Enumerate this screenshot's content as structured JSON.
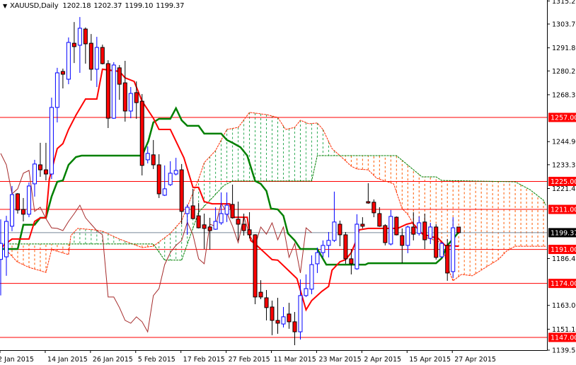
{
  "header": {
    "dropdown_icon": "triangle-down-icon",
    "symbol_timeframe": "XAUUSD,Daily",
    "ohlc": [
      "1202.18",
      "1202.37",
      "1199.10",
      "1199.37"
    ]
  },
  "colors": {
    "up_candle": "#0000ff",
    "down_candle_fill": "#ff0000",
    "down_candle_outline": "#000000",
    "tenkan": "#ff0000",
    "kijun": "#008000",
    "senkou_a": "#ff2a00",
    "senkou_b": "#008000",
    "chikou": "#a52a2a",
    "cloud_bear_hatch": "#ff5a00",
    "cloud_bull_hatch": "#2eaa55",
    "level_line": "#ff0000",
    "current_price_line": "#778899"
  },
  "chart_data": {
    "type": "candlestick",
    "title": "XAUUSD,Daily",
    "indicator": "Ichimoku Kinko Hyo",
    "ylim": [
      1139.55,
      1315.25
    ],
    "y_ticks": [
      "1315.25",
      "1303.70",
      "1291.80",
      "1280.25",
      "1268.35",
      "1244.90",
      "1233.35",
      "1221.45",
      "1186.45",
      "1163.00",
      "1151.10",
      "1139.55"
    ],
    "x_tick_labels": [
      {
        "bar": 0,
        "label": "2 Jan 2015"
      },
      {
        "bar": 8,
        "label": "14 Jan 2015"
      },
      {
        "bar": 16,
        "label": "26 Jan 2015"
      },
      {
        "bar": 24,
        "label": "5 Feb 2015"
      },
      {
        "bar": 32,
        "label": "17 Feb 2015"
      },
      {
        "bar": 40,
        "label": "27 Feb 2015"
      },
      {
        "bar": 48,
        "label": "11 Mar 2015"
      },
      {
        "bar": 56,
        "label": "23 Mar 2015"
      },
      {
        "bar": 64,
        "label": "2 Apr 2015"
      },
      {
        "bar": 72,
        "label": "15 Apr 2015"
      },
      {
        "bar": 80,
        "label": "27 Apr 2015"
      }
    ],
    "levels": [
      {
        "price": 1257.0,
        "label": "1257.00"
      },
      {
        "price": 1225.0,
        "label": "1225.00"
      },
      {
        "price": 1211.0,
        "label": "1211.00"
      },
      {
        "price": 1191.0,
        "label": "1191.00"
      },
      {
        "price": 1174.0,
        "label": "1174.00"
      },
      {
        "price": 1147.0,
        "label": "1147.00"
      }
    ],
    "current_price": {
      "price": 1199.37,
      "label": "1199.37"
    },
    "ohlc": [
      [
        1186.0,
        1206.0,
        1168.0,
        1194.0
      ],
      [
        1187.3,
        1207.8,
        1177.8,
        1205.0
      ],
      [
        1202.6,
        1222.7,
        1200.1,
        1218.4
      ],
      [
        1218.8,
        1219.2,
        1208.9,
        1210.7
      ],
      [
        1211.0,
        1216.7,
        1205.0,
        1208.6
      ],
      [
        1208.6,
        1224.5,
        1207.1,
        1222.7
      ],
      [
        1223.8,
        1235.8,
        1217.4,
        1233.7
      ],
      [
        1233.3,
        1244.3,
        1227.3,
        1230.8
      ],
      [
        1230.8,
        1244.3,
        1225.5,
        1228.7
      ],
      [
        1228.7,
        1266.9,
        1226.2,
        1262.0
      ],
      [
        1262.0,
        1281.8,
        1254.5,
        1279.3
      ],
      [
        1280.0,
        1281.4,
        1271.5,
        1278.6
      ],
      [
        1276.1,
        1297.0,
        1273.6,
        1294.5
      ],
      [
        1294.1,
        1304.7,
        1284.2,
        1292.4
      ],
      [
        1293.1,
        1307.2,
        1279.3,
        1301.6
      ],
      [
        1301.2,
        1302.0,
        1283.9,
        1293.8
      ],
      [
        1294.1,
        1298.7,
        1275.4,
        1281.1
      ],
      [
        1281.1,
        1297.3,
        1272.2,
        1292.0
      ],
      [
        1292.0,
        1293.4,
        1283.5,
        1283.9
      ],
      [
        1283.9,
        1285.6,
        1251.7,
        1256.6
      ],
      [
        1256.6,
        1284.6,
        1256.3,
        1283.2
      ],
      [
        1281.8,
        1283.2,
        1265.8,
        1273.6
      ],
      [
        1274.3,
        1285.3,
        1254.9,
        1260.2
      ],
      [
        1260.2,
        1272.2,
        1256.6,
        1269.0
      ],
      [
        1269.4,
        1275.0,
        1256.3,
        1264.4
      ],
      [
        1265.1,
        1268.7,
        1228.0,
        1233.0
      ],
      [
        1235.8,
        1242.5,
        1234.0,
        1239.0
      ],
      [
        1238.3,
        1245.7,
        1231.2,
        1233.3
      ],
      [
        1233.3,
        1238.6,
        1216.7,
        1218.8
      ],
      [
        1218.1,
        1233.0,
        1217.7,
        1221.3
      ],
      [
        1223.4,
        1235.1,
        1222.7,
        1229.1
      ],
      [
        1228.7,
        1236.8,
        1228.0,
        1230.5
      ],
      [
        1230.8,
        1233.7,
        1203.6,
        1210.0
      ],
      [
        1208.9,
        1213.5,
        1198.3,
        1212.1
      ],
      [
        1212.8,
        1221.3,
        1206.1,
        1206.4
      ],
      [
        1207.8,
        1214.2,
        1201.5,
        1201.8
      ],
      [
        1203.3,
        1208.9,
        1191.2,
        1201.5
      ],
      [
        1202.2,
        1206.8,
        1190.9,
        1200.4
      ],
      [
        1201.1,
        1212.1,
        1200.8,
        1205.0
      ],
      [
        1204.3,
        1219.5,
        1203.3,
        1208.9
      ],
      [
        1208.6,
        1219.5,
        1204.7,
        1213.1
      ],
      [
        1213.5,
        1223.4,
        1206.4,
        1206.8
      ],
      [
        1206.1,
        1214.9,
        1195.5,
        1203.6
      ],
      [
        1203.6,
        1208.9,
        1197.9,
        1200.4
      ],
      [
        1200.8,
        1209.6,
        1196.5,
        1198.3
      ],
      [
        1198.3,
        1198.6,
        1163.6,
        1167.2
      ],
      [
        1169.6,
        1175.6,
        1166.1,
        1167.2
      ],
      [
        1166.8,
        1170.7,
        1155.5,
        1161.9
      ],
      [
        1162.2,
        1165.4,
        1148.1,
        1155.5
      ],
      [
        1155.5,
        1166.8,
        1148.8,
        1154.1
      ],
      [
        1153.7,
        1162.2,
        1152.0,
        1157.3
      ],
      [
        1158.7,
        1164.3,
        1151.3,
        1154.8
      ],
      [
        1154.8,
        1159.7,
        1143.1,
        1149.8
      ],
      [
        1149.8,
        1176.0,
        1145.9,
        1167.9
      ],
      [
        1167.9,
        1178.5,
        1167.2,
        1171.4
      ],
      [
        1171.1,
        1188.0,
        1168.6,
        1183.4
      ],
      [
        1183.8,
        1191.9,
        1179.2,
        1189.4
      ],
      [
        1189.4,
        1195.5,
        1187.0,
        1193.0
      ],
      [
        1193.0,
        1199.7,
        1187.0,
        1195.5
      ],
      [
        1195.5,
        1219.9,
        1194.7,
        1204.7
      ],
      [
        1203.6,
        1205.4,
        1192.6,
        1198.3
      ],
      [
        1198.3,
        1199.7,
        1183.8,
        1186.3
      ],
      [
        1186.3,
        1191.2,
        1178.5,
        1183.8
      ],
      [
        1181.3,
        1208.6,
        1180.8,
        1203.6
      ],
      [
        1203.6,
        1207.1,
        1201.5,
        1202.6
      ],
      [
        1214.9,
        1224.1,
        1213.8,
        1214.2
      ],
      [
        1214.6,
        1216.0,
        1207.1,
        1209.3
      ],
      [
        1208.9,
        1212.1,
        1202.3,
        1202.6
      ],
      [
        1202.9,
        1203.6,
        1193.0,
        1194.4
      ],
      [
        1193.7,
        1210.7,
        1193.0,
        1207.5
      ],
      [
        1207.1,
        1207.5,
        1198.0,
        1198.3
      ],
      [
        1197.9,
        1201.5,
        1184.1,
        1193.0
      ],
      [
        1193.0,
        1202.9,
        1189.1,
        1202.2
      ],
      [
        1202.2,
        1209.6,
        1195.5,
        1198.6
      ],
      [
        1199.0,
        1207.5,
        1197.9,
        1204.3
      ],
      [
        1204.7,
        1208.9,
        1191.2,
        1195.8
      ],
      [
        1196.5,
        1204.3,
        1193.7,
        1202.2
      ],
      [
        1202.2,
        1203.6,
        1185.9,
        1187.0
      ],
      [
        1187.3,
        1194.7,
        1186.9,
        1194.0
      ],
      [
        1193.0,
        1196.2,
        1175.3,
        1179.2
      ],
      [
        1179.9,
        1207.1,
        1176.7,
        1201.8
      ],
      [
        1202.18,
        1202.37,
        1199.1,
        1199.37
      ]
    ],
    "tenkan_sen": [
      [
        0,
        1191.9
      ],
      [
        2,
        1196.2
      ],
      [
        5,
        1196.2
      ],
      [
        6,
        1205.0
      ],
      [
        7,
        1206.8
      ],
      [
        8,
        1206.8
      ],
      [
        8.6,
        1226.2
      ],
      [
        10,
        1241.4
      ],
      [
        11,
        1243.9
      ],
      [
        12,
        1251.0
      ],
      [
        13.3,
        1258.1
      ],
      [
        15,
        1266.2
      ],
      [
        17,
        1266.2
      ],
      [
        18,
        1281.1
      ],
      [
        21,
        1280.0
      ],
      [
        22,
        1276.8
      ],
      [
        23.6,
        1275.0
      ],
      [
        25,
        1265.1
      ],
      [
        26,
        1260.9
      ],
      [
        27,
        1256.6
      ],
      [
        28,
        1251.0
      ],
      [
        30,
        1251.0
      ],
      [
        32.4,
        1236.8
      ],
      [
        34,
        1222.0
      ],
      [
        35,
        1222.0
      ],
      [
        36,
        1214.9
      ],
      [
        37.4,
        1213.8
      ],
      [
        40.5,
        1213.8
      ],
      [
        41,
        1207.1
      ],
      [
        43.6,
        1207.1
      ],
      [
        44.2,
        1195.5
      ],
      [
        45,
        1193.7
      ],
      [
        48,
        1185.9
      ],
      [
        49,
        1185.6
      ],
      [
        51,
        1180.2
      ],
      [
        52.4,
        1176.4
      ],
      [
        54,
        1160.8
      ],
      [
        55,
        1165.4
      ],
      [
        56.8,
        1170.0
      ],
      [
        58,
        1172.5
      ],
      [
        58.6,
        1180.6
      ],
      [
        60,
        1184.8
      ],
      [
        61,
        1185.9
      ],
      [
        62,
        1189.4
      ],
      [
        63,
        1196.2
      ],
      [
        63.4,
        1200.8
      ],
      [
        65,
        1201.5
      ],
      [
        70.2,
        1201.5
      ],
      [
        71.8,
        1203.6
      ],
      [
        72.8,
        1204.3
      ],
      [
        74.5,
        1199.0
      ],
      [
        75.8,
        1197.6
      ],
      [
        77.4,
        1196.5
      ],
      [
        78.6,
        1193.0
      ],
      [
        81,
        1192.6
      ]
    ],
    "kijun_sen": [
      [
        0,
        1191.2
      ],
      [
        3,
        1191.2
      ],
      [
        4,
        1203.3
      ],
      [
        6,
        1203.3
      ],
      [
        7,
        1206.8
      ],
      [
        8,
        1206.8
      ],
      [
        9,
        1217.4
      ],
      [
        10,
        1224.8
      ],
      [
        11,
        1225.5
      ],
      [
        12,
        1233.3
      ],
      [
        13.3,
        1237.2
      ],
      [
        14.3,
        1237.9
      ],
      [
        25,
        1237.9
      ],
      [
        26.1,
        1245.0
      ],
      [
        27,
        1254.5
      ],
      [
        28,
        1256.3
      ],
      [
        30,
        1256.3
      ],
      [
        31,
        1261.6
      ],
      [
        32,
        1255.6
      ],
      [
        33,
        1252.8
      ],
      [
        35,
        1252.8
      ],
      [
        36,
        1248.9
      ],
      [
        39,
        1248.9
      ],
      [
        40,
        1245.7
      ],
      [
        41,
        1244.3
      ],
      [
        42.4,
        1242.1
      ],
      [
        43.6,
        1237.9
      ],
      [
        45,
        1225.2
      ],
      [
        46,
        1223.8
      ],
      [
        47,
        1220.2
      ],
      [
        47.8,
        1211.4
      ],
      [
        49,
        1211.0
      ],
      [
        50,
        1207.8
      ],
      [
        50.8,
        1199.0
      ],
      [
        52,
        1195.5
      ],
      [
        53,
        1191.2
      ],
      [
        56,
        1191.2
      ],
      [
        57.6,
        1183.4
      ],
      [
        64.5,
        1183.4
      ],
      [
        65,
        1184.1
      ],
      [
        77,
        1184.1
      ],
      [
        78,
        1186.6
      ],
      [
        79,
        1193.0
      ],
      [
        80,
        1196.2
      ],
      [
        81,
        1199.7
      ]
    ],
    "senkou_span_a": [
      [
        0,
        1193.7
      ],
      [
        2.9,
        1184.8
      ],
      [
        5,
        1182.0
      ],
      [
        8,
        1179.5
      ],
      [
        9,
        1190.9
      ],
      [
        12,
        1188.4
      ],
      [
        12.4,
        1197.9
      ],
      [
        13.6,
        1201.5
      ],
      [
        16.5,
        1200.8
      ],
      [
        18,
        1200.1
      ],
      [
        21,
        1196.2
      ],
      [
        25,
        1191.9
      ],
      [
        27,
        1192.6
      ],
      [
        30,
        1199.0
      ],
      [
        32,
        1205.4
      ],
      [
        35,
        1226.2
      ],
      [
        36,
        1234.4
      ],
      [
        38,
        1240.4
      ],
      [
        40,
        1251.0
      ],
      [
        42,
        1252.0
      ],
      [
        44,
        1259.5
      ],
      [
        47,
        1258.4
      ],
      [
        49,
        1257.0
      ],
      [
        50.4,
        1251.0
      ],
      [
        52,
        1252.0
      ],
      [
        53,
        1255.6
      ],
      [
        54.5,
        1253.8
      ],
      [
        56,
        1254.2
      ],
      [
        57,
        1251.0
      ],
      [
        58.6,
        1241.4
      ],
      [
        60,
        1237.9
      ],
      [
        62,
        1232.6
      ],
      [
        63,
        1231.2
      ],
      [
        65,
        1230.8
      ],
      [
        66.5,
        1226.6
      ],
      [
        69.5,
        1223.8
      ],
      [
        71,
        1211.4
      ],
      [
        72,
        1208.5
      ],
      [
        73,
        1203.6
      ],
      [
        75,
        1197.2
      ],
      [
        78,
        1194.4
      ],
      [
        79,
        1182.4
      ],
      [
        80,
        1175.3
      ],
      [
        81.5,
        1178.5
      ],
      [
        83.4,
        1177.8
      ],
      [
        86,
        1182.4
      ],
      [
        88,
        1185.9
      ],
      [
        89.5,
        1190.2
      ],
      [
        91,
        1192.6
      ],
      [
        96.4,
        1192.6
      ]
    ],
    "senkou_span_b": [
      [
        0,
        1193.7
      ],
      [
        27,
        1193.7
      ],
      [
        29,
        1185.6
      ],
      [
        32,
        1185.6
      ],
      [
        35,
        1209.6
      ],
      [
        39.5,
        1223.0
      ],
      [
        41,
        1225.2
      ],
      [
        55,
        1225.2
      ],
      [
        56,
        1237.9
      ],
      [
        70,
        1237.9
      ],
      [
        74.5,
        1227.3
      ],
      [
        77,
        1227.3
      ],
      [
        78,
        1225.5
      ],
      [
        91,
        1224.8
      ],
      [
        93.6,
        1220.9
      ],
      [
        96,
        1215.6
      ],
      [
        96.4,
        1213.1
      ]
    ],
    "chikou_shift": 26
  }
}
